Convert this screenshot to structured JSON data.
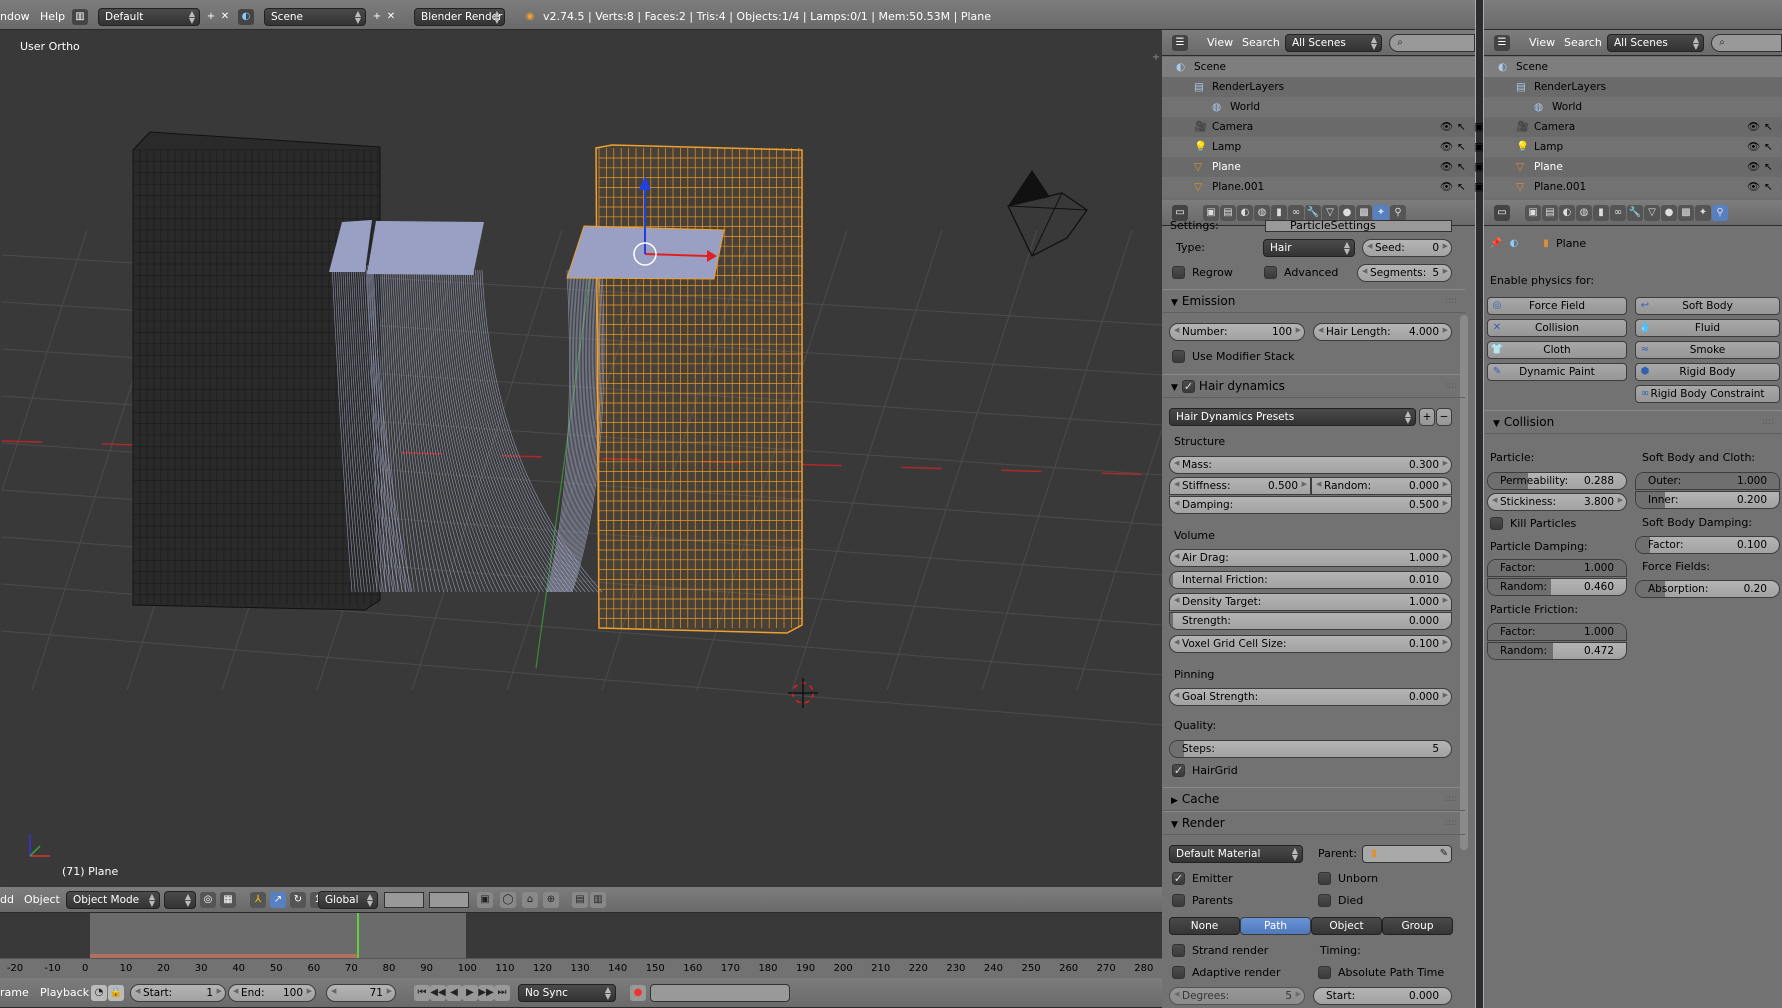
{
  "topbar": {
    "menus": [
      "ndow",
      "Help"
    ],
    "screen_layout": "Default",
    "scene": "Scene",
    "render_engine": "Blender Render",
    "stats": "v2.74.5 | Verts:8 | Faces:2 | Tris:4 | Objects:1/4 | Lamps:0/1 | Mem:50.53M | Plane"
  },
  "viewport": {
    "view_label": "User Ortho",
    "object_label": "(71) Plane",
    "header": {
      "menus": [
        "dd",
        "Object"
      ],
      "mode": "Object Mode",
      "orientation": "Global"
    }
  },
  "timeline": {
    "ticks": [
      "-20",
      "-10",
      "0",
      "10",
      "20",
      "30",
      "40",
      "50",
      "60",
      "70",
      "80",
      "90",
      "100",
      "110",
      "120",
      "130",
      "140",
      "150",
      "160",
      "170",
      "180",
      "190",
      "200",
      "210",
      "220",
      "230",
      "240",
      "250",
      "260",
      "270",
      "280"
    ],
    "menus": [
      "rame",
      "Playback"
    ],
    "start_label": "Start:",
    "start": "1",
    "end_label": "End:",
    "end": "100",
    "current_frame": "71",
    "sync": "No Sync",
    "range_start": 1,
    "range_end": 100
  },
  "outliner": {
    "menus": [
      "View",
      "Search"
    ],
    "filter": "All Scenes",
    "items": [
      {
        "label": "Scene",
        "icon": "scene-icon"
      },
      {
        "label": "RenderLayers",
        "icon": "render-layers-icon"
      },
      {
        "label": "World",
        "icon": "world-icon"
      },
      {
        "label": "Camera",
        "icon": "camera-icon"
      },
      {
        "label": "Lamp",
        "icon": "lamp-icon"
      },
      {
        "label": "Plane",
        "icon": "mesh-icon"
      },
      {
        "label": "Plane.001",
        "icon": "mesh-icon"
      }
    ]
  },
  "particles": {
    "settings_label": "Settings:",
    "settings_value": "ParticleSettings",
    "type_label": "Type:",
    "type": "Hair",
    "seed": {
      "label": "Seed:",
      "value": "0"
    },
    "regrow": "Regrow",
    "advanced": "Advanced",
    "segments": {
      "label": "Segments:",
      "value": "5"
    },
    "emission": {
      "title": "Emission",
      "number": {
        "label": "Number:",
        "value": "100"
      },
      "hair_length": {
        "label": "Hair Length:",
        "value": "4.000"
      },
      "use_modifier_stack": "Use Modifier Stack"
    },
    "hair_dynamics": {
      "title": "Hair dynamics",
      "enabled": true,
      "presets": "Hair Dynamics Presets",
      "structure": "Structure",
      "mass": {
        "label": "Mass:",
        "value": "0.300"
      },
      "stiffness": {
        "label": "Stiffness:",
        "value": "0.500"
      },
      "random": {
        "label": "Random:",
        "value": "0.000"
      },
      "damping": {
        "label": "Damping:",
        "value": "0.500"
      },
      "volume": "Volume",
      "air_drag": {
        "label": "Air Drag:",
        "value": "1.000"
      },
      "internal_friction": {
        "label": "Internal Friction:",
        "value": "0.010"
      },
      "density_target": {
        "label": "Density Target:",
        "value": "1.000"
      },
      "strength": {
        "label": "Strength:",
        "value": "0.000"
      },
      "voxel": {
        "label": "Voxel Grid Cell Size:",
        "value": "0.100"
      },
      "pinning": "Pinning",
      "goal_strength": {
        "label": "Goal Strength:",
        "value": "0.000"
      },
      "quality": "Quality:",
      "steps": {
        "label": "Steps:",
        "value": "5"
      },
      "hairgrid": "HairGrid"
    },
    "cache": {
      "title": "Cache"
    },
    "render": {
      "title": "Render",
      "material": "Default Material",
      "parent_label": "Parent:",
      "emitter": "Emitter",
      "unborn": "Unborn",
      "parents": "Parents",
      "died": "Died",
      "modes": [
        "None",
        "Path",
        "Object",
        "Group"
      ],
      "active_mode": "Path",
      "strand_render": "Strand render",
      "timing": "Timing:",
      "adaptive_render": "Adaptive render",
      "absolute_path_time": "Absolute Path Time",
      "degrees": {
        "label": "Degrees:",
        "value": "5"
      },
      "start": {
        "label": "Start:",
        "value": "0.000"
      }
    }
  },
  "physics": {
    "object": "Plane",
    "enable_label": "Enable physics for:",
    "buttons_left": [
      "Force Field",
      "Collision",
      "Cloth",
      "Dynamic Paint"
    ],
    "buttons_right": [
      "Soft Body",
      "Fluid",
      "Smoke",
      "Rigid Body",
      "Rigid Body Constraint"
    ],
    "collision": {
      "title": "Collision",
      "particle": "Particle:",
      "permeability": {
        "label": "Permeability:",
        "value": "0.288"
      },
      "stickiness": {
        "label": "Stickiness:",
        "value": "3.800"
      },
      "kill_particles": "Kill Particles",
      "particle_damping": "Particle Damping:",
      "pd_factor": {
        "label": "Factor:",
        "value": "1.000"
      },
      "pd_random": {
        "label": "Random:",
        "value": "0.460"
      },
      "particle_friction": "Particle Friction:",
      "pf_factor": {
        "label": "Factor:",
        "value": "1.000"
      },
      "pf_random": {
        "label": "Random:",
        "value": "0.472"
      },
      "soft_body_cloth": "Soft Body and Cloth:",
      "outer": {
        "label": "Outer:",
        "value": "1.000"
      },
      "inner": {
        "label": "Inner:",
        "value": "0.200"
      },
      "soft_body_damping": "Soft Body Damping:",
      "sb_factor": {
        "label": "Factor:",
        "value": "0.100"
      },
      "force_fields": "Force Fields:",
      "absorption": {
        "label": "Absorption:",
        "value": "0.20"
      }
    }
  },
  "colors": {
    "accent": "#5680c2",
    "selected_object": "#f0a030",
    "panel": "#727272",
    "viewport": "#393939"
  }
}
